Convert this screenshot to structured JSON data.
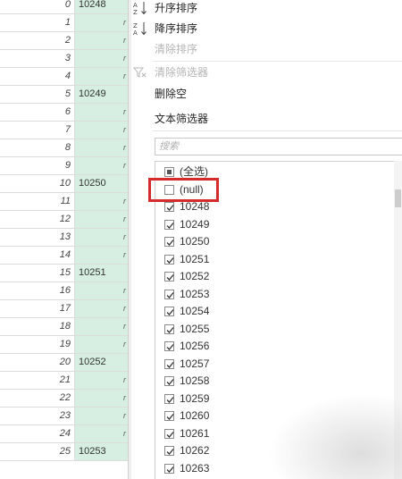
{
  "grid": {
    "rows": [
      {
        "index": "0",
        "value": "10248",
        "mark": ""
      },
      {
        "index": "1",
        "value": "",
        "mark": "r"
      },
      {
        "index": "2",
        "value": "",
        "mark": "r"
      },
      {
        "index": "3",
        "value": "",
        "mark": "r"
      },
      {
        "index": "4",
        "value": "",
        "mark": "r"
      },
      {
        "index": "5",
        "value": "10249",
        "mark": ""
      },
      {
        "index": "6",
        "value": "",
        "mark": "r"
      },
      {
        "index": "7",
        "value": "",
        "mark": "r"
      },
      {
        "index": "8",
        "value": "",
        "mark": "r"
      },
      {
        "index": "9",
        "value": "",
        "mark": "r"
      },
      {
        "index": "10",
        "value": "10250",
        "mark": ""
      },
      {
        "index": "11",
        "value": "",
        "mark": "r"
      },
      {
        "index": "12",
        "value": "",
        "mark": "r"
      },
      {
        "index": "13",
        "value": "",
        "mark": "r"
      },
      {
        "index": "14",
        "value": "",
        "mark": "r"
      },
      {
        "index": "15",
        "value": "10251",
        "mark": ""
      },
      {
        "index": "16",
        "value": "",
        "mark": "r"
      },
      {
        "index": "17",
        "value": "",
        "mark": "r"
      },
      {
        "index": "18",
        "value": "",
        "mark": "r"
      },
      {
        "index": "19",
        "value": "",
        "mark": "r"
      },
      {
        "index": "20",
        "value": "10252",
        "mark": ""
      },
      {
        "index": "21",
        "value": "",
        "mark": "r"
      },
      {
        "index": "22",
        "value": "",
        "mark": "r"
      },
      {
        "index": "23",
        "value": "",
        "mark": "r"
      },
      {
        "index": "24",
        "value": "",
        "mark": "r"
      },
      {
        "index": "25",
        "value": "10253",
        "mark": ""
      }
    ]
  },
  "menu": {
    "sort_asc": "升序排序",
    "sort_desc": "降序排序",
    "clear_sort": "清除排序",
    "clear_filter": "清除筛选器",
    "remove_empty": "删除空",
    "text_filters": "文本筛选器",
    "search_placeholder": "搜索",
    "options": [
      {
        "label": "(全选)",
        "state": "partial"
      },
      {
        "label": "(null)",
        "state": "unchecked"
      },
      {
        "label": "10248",
        "state": "checked"
      },
      {
        "label": "10249",
        "state": "checked"
      },
      {
        "label": "10250",
        "state": "checked"
      },
      {
        "label": "10251",
        "state": "checked"
      },
      {
        "label": "10252",
        "state": "checked"
      },
      {
        "label": "10253",
        "state": "checked"
      },
      {
        "label": "10254",
        "state": "checked"
      },
      {
        "label": "10255",
        "state": "checked"
      },
      {
        "label": "10256",
        "state": "checked"
      },
      {
        "label": "10257",
        "state": "checked"
      },
      {
        "label": "10258",
        "state": "checked"
      },
      {
        "label": "10259",
        "state": "checked"
      },
      {
        "label": "10260",
        "state": "checked"
      },
      {
        "label": "10261",
        "state": "checked"
      },
      {
        "label": "10262",
        "state": "checked"
      },
      {
        "label": "10263",
        "state": "checked"
      }
    ]
  },
  "colors": {
    "column_fill": "#d6efe2",
    "highlight_border": "#d62b2b"
  }
}
